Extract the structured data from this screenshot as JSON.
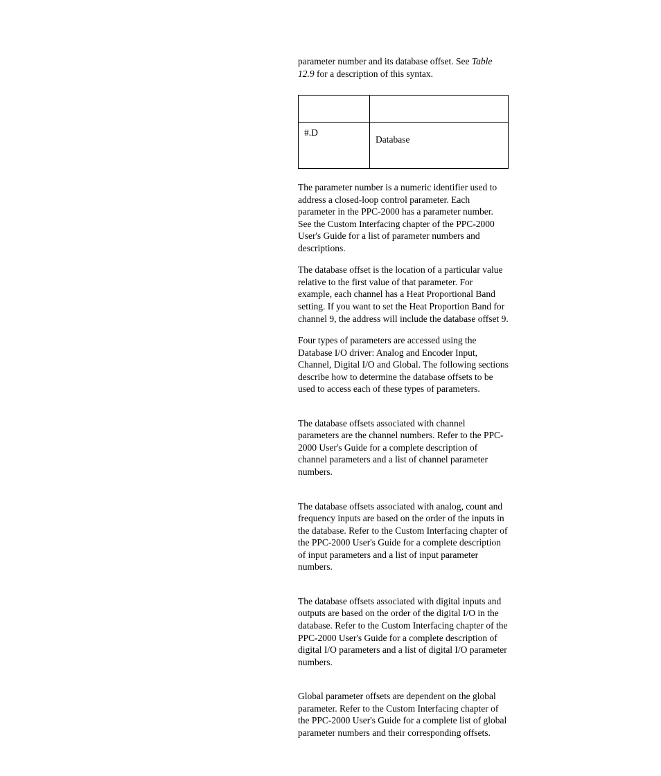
{
  "intro": {
    "text_before_ref": "parameter number and its database offset. See ",
    "ref": "Table 12.9",
    "text_after_ref": " for a description of this syntax."
  },
  "table": {
    "left": "#.D",
    "right": "Database"
  },
  "paragraphs": {
    "p1": "The parameter number  is a numeric identifier used to address a closed-loop control parameter. Each parameter in the PPC-2000 has a parameter number. See the Custom Interfacing chapter of the PPC-2000 User's Guide for a list of parameter numbers and descriptions.",
    "p2": "The database offset is the location of a particular value relative to the first value of that parameter. For example, each channel has a Heat Proportional Band setting. If you want to set the Heat Proportion Band for channel 9, the address will include the database offset 9.",
    "p3": "Four types of parameters are accessed using the Database I/O driver: Analog and Encoder Input, Channel, Digital I/O and Global. The following sections describe how to determine the database offsets to be used to access each of these types of parameters.",
    "p4": "The database offsets associated with channel parameters are the channel numbers. Refer to the PPC-2000 User's Guide for a complete description of channel parameters and a list of channel parameter numbers.",
    "p5": "The database offsets associated with analog, count and frequency inputs are based on the order of the inputs in the database. Refer to the Custom Interfacing chapter of the PPC-2000 User's Guide for a complete description of input parameters and a list of input parameter numbers.",
    "p6": "The database offsets associated with digital inputs and outputs are based on the order of the digital I/O in the database. Refer to the Custom Interfacing chapter of the PPC-2000 User's Guide  for a complete description of digital I/O parameters and a list of digital I/O parameter numbers.",
    "p7": "Global parameter offsets are dependent on the global parameter. Refer to the Custom Interfacing chapter of the PPC-2000 User's Guide for a complete list of global parameter numbers and their corresponding offsets."
  }
}
